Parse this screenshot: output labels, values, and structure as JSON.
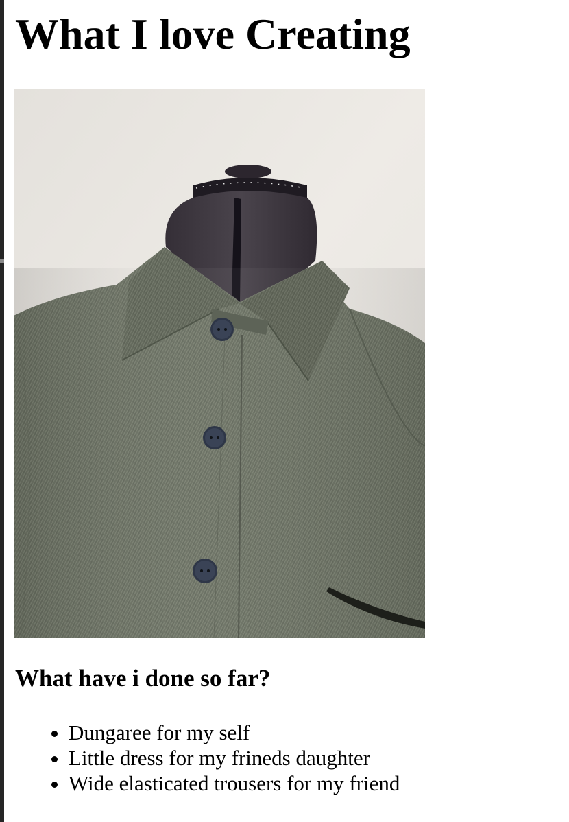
{
  "page": {
    "title": "What I love Creating",
    "photo_alt": "",
    "section_heading": "What have i done so far?",
    "list_items": [
      "Dungaree for my self",
      "Little dress for my frineds daughter",
      "Wide elasticated trousers for my friend"
    ]
  },
  "colors": {
    "wall": "#e9e6e1",
    "fabric": "#6b7163",
    "dress_form": "#3b353c",
    "buttons": "#2e3647"
  }
}
